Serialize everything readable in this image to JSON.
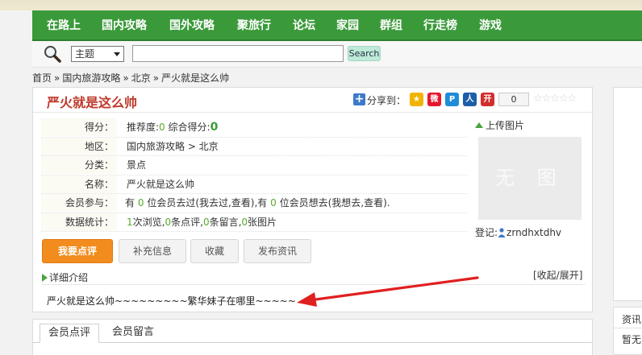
{
  "nav": {
    "items": [
      "在路上",
      "国内攻略",
      "国外攻略",
      "聚旅行",
      "论坛",
      "家园",
      "群组",
      "行走榜",
      "游戏"
    ]
  },
  "search": {
    "type_selected": "主题",
    "query": "",
    "button_label": "Search",
    "icon": "magnifier-icon"
  },
  "breadcrumb": {
    "items": [
      "首页",
      "国内旅游攻略",
      "北京",
      "严火就是这么帅"
    ],
    "separator": "»"
  },
  "place": {
    "title": "严火就是这么帅",
    "share_label": "分享到：",
    "share_count": "0",
    "share_icons": [
      {
        "icon": "qzone-icon",
        "color": "#f0b400",
        "glyph": "★"
      },
      {
        "icon": "weibo-icon",
        "color": "#e6162d",
        "glyph": "微"
      },
      {
        "icon": "tencent-icon",
        "color": "#1e8cd8",
        "glyph": "P"
      },
      {
        "icon": "renren-icon",
        "color": "#1c5ea8",
        "glyph": "人"
      },
      {
        "icon": "kaixin-icon",
        "color": "#d12f2f",
        "glyph": "开"
      }
    ],
    "rating_stars": 0
  },
  "info": {
    "score_label": "得分：",
    "recommend_text": "推荐度:",
    "recommend_value": "0",
    "overall_text": "综合得分:",
    "overall_value": "0",
    "region_label": "地区：",
    "region_value": "国内旅游攻略 > 北京",
    "category_label": "分类：",
    "category_value": "景点",
    "name_label": "名称：",
    "name_value": "严火就是这么帅",
    "members_label": "会员参与：",
    "members_pre": "有",
    "members_went": "0",
    "members_mid": "位会员去过(我去过,查看),有",
    "members_want": "0",
    "members_post": "位会员想去(我想去,查看).",
    "stats_label": "数据统计：",
    "views": "1",
    "views_text": "次浏览,",
    "reviews": "0",
    "reviews_text": "条点评,",
    "comments": "0",
    "comments_text": "条留言,",
    "photos": "0",
    "photos_text": "张图片"
  },
  "actions": {
    "review": "我要点评",
    "supplement": "补充信息",
    "favorite": "收藏",
    "publish": "发布资讯"
  },
  "image_box": {
    "upload_label": "上传图片",
    "placeholder": "无 图",
    "registered_label": "登记:",
    "registered_user": "zrndhxtdhv"
  },
  "detail": {
    "heading": "详细介绍",
    "toggle": "[收起/展开]",
    "text": "严火就是这么帅~~~~~~~~~繁华妹子在哪里~~~~~"
  },
  "tabs": [
    "会员点评",
    "会员留言"
  ],
  "sidebar": {
    "heading": "资讯",
    "text": "暂无"
  },
  "colors": {
    "nav_green": "#3a9a3a",
    "title_red": "#c0392b",
    "primary_orange": "#f28c1e",
    "annotation_red": "#e02020"
  }
}
